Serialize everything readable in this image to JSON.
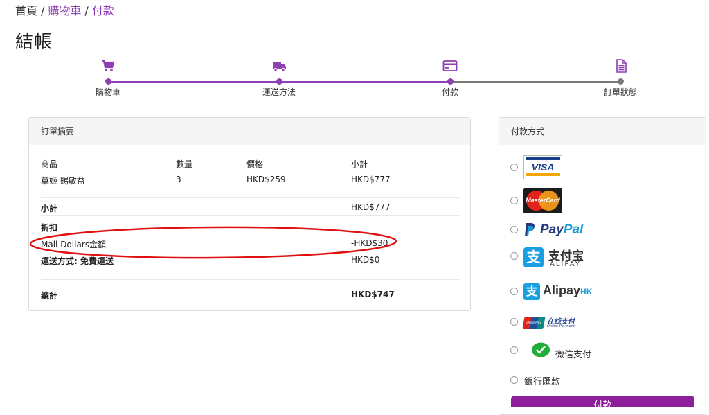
{
  "breadcrumb": {
    "home": "首頁",
    "cart": "購物車",
    "current": "付款",
    "sep": "/"
  },
  "page_title": "結帳",
  "steps": [
    {
      "label": "購物車",
      "icon": "cart-icon"
    },
    {
      "label": "運送方法",
      "icon": "truck-icon"
    },
    {
      "label": "付款",
      "icon": "credit-card-icon"
    },
    {
      "label": "訂單狀態",
      "icon": "document-icon"
    }
  ],
  "colors": {
    "accent": "#8e3fb3",
    "inactive": "#777777",
    "annotation": "#e01010",
    "pay_button": "#8e1f9c"
  },
  "order_summary": {
    "title": "訂單摘要",
    "headers": {
      "product": "商品",
      "qty": "數量",
      "price": "價格",
      "subtotal": "小計"
    },
    "item": {
      "product": "草姬 賜敏益",
      "qty": "3",
      "price": "HKD$259",
      "subtotal": "HKD$777"
    },
    "subtotal_label": "小計",
    "subtotal_value": "HKD$777",
    "discount_label": "折扣",
    "mall_dollars_label": "Mall Dollars金額",
    "mall_dollars_value": "-HKD$30",
    "shipping_label": "運送方式: 免費運送",
    "shipping_value": "HKD$0",
    "total_label": "總計",
    "total_value": "HKD$747"
  },
  "payment": {
    "title": "付款方式",
    "visa": "VISA",
    "mastercard": "MasterCard",
    "paypal_pay": "Pay",
    "paypal_pal": "Pal",
    "alipay_cn": "支付宝",
    "alipay_en": "ALIPAY",
    "alipayhk": "Alipay",
    "alipayhk_suffix": "HK",
    "unionpay_cn": "在线支付",
    "unionpay_en": "Online Payment",
    "unionpay_logo": "UnionPay",
    "wechat": "微信支付",
    "bank": "銀行匯款",
    "pay_button": "付款"
  }
}
